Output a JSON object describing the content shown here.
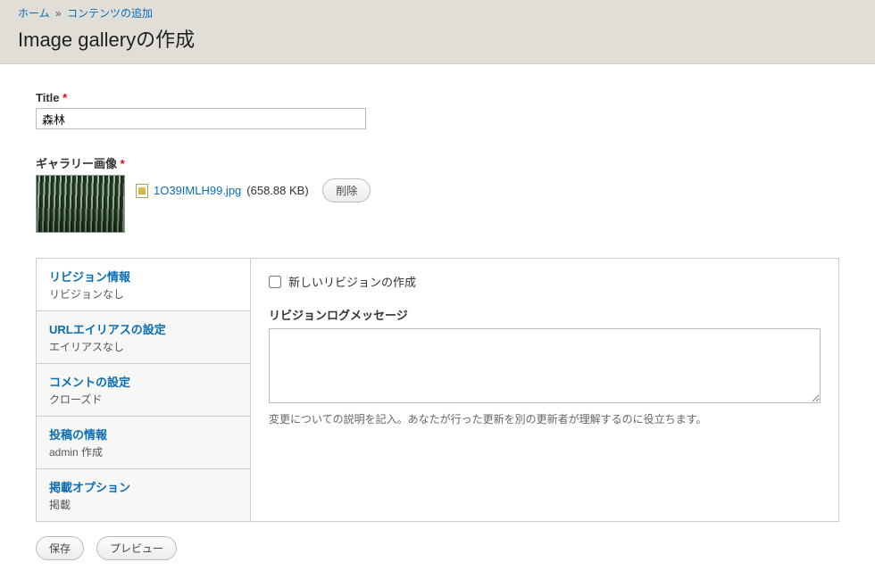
{
  "breadcrumb": {
    "home": "ホーム",
    "add_content": "コンテンツの追加",
    "separator": "»"
  },
  "page_title": "Image galleryの作成",
  "form": {
    "title_label": "Title",
    "title_value": "森林",
    "gallery_label": "ギャラリー画像",
    "file_name": "1O39IMLH99.jpg",
    "file_size": "(658.88 KB)",
    "remove_button": "削除"
  },
  "tabs": [
    {
      "title": "リビジョン情報",
      "summary": "リビジョンなし"
    },
    {
      "title": "URLエイリアスの設定",
      "summary": "エイリアスなし"
    },
    {
      "title": "コメントの設定",
      "summary": "クローズド"
    },
    {
      "title": "投稿の情報",
      "summary": "admin 作成"
    },
    {
      "title": "掲載オプション",
      "summary": "掲載"
    }
  ],
  "revision_panel": {
    "checkbox_label": "新しいリビジョンの作成",
    "log_label": "リビジョンログメッセージ",
    "log_value": "",
    "help": "変更についての説明を記入。あなたが行った更新を別の更新者が理解するのに役立ちます。"
  },
  "actions": {
    "save": "保存",
    "preview": "プレビュー"
  }
}
